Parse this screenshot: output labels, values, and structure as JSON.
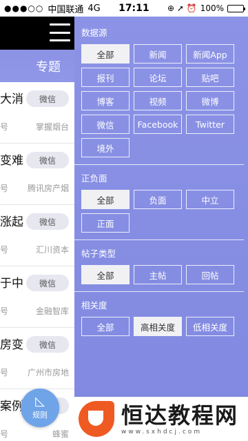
{
  "status_bar": {
    "signal": "●●●○○",
    "carrier": "中国联通",
    "network": "4G",
    "time": "17:11",
    "icons": "⊕ ➚ ⏰",
    "battery_pct": "100%",
    "battery_level": 1.0
  },
  "left": {
    "header": "专题",
    "items": [
      {
        "title": "大消",
        "badge": "微信",
        "meta_left": "号",
        "meta_right": "掌握烟台"
      },
      {
        "title": "变难",
        "badge": "微信",
        "meta_left": "号",
        "meta_right": "腾讯房产烟"
      },
      {
        "title": "涨起",
        "badge": "微信",
        "meta_left": "号",
        "meta_right": "汇川资本"
      },
      {
        "title": "于中",
        "badge": "微信",
        "meta_left": "号",
        "meta_right": "金融智库"
      },
      {
        "title": "房变",
        "badge": "微信",
        "meta_left": "号",
        "meta_right": "广州市房地"
      },
      {
        "title": "案例/",
        "badge": "微信",
        "meta_left": "号",
        "meta_right": "蜂蜜"
      }
    ],
    "rules_button": "规则"
  },
  "drawer": {
    "source": {
      "title": "数据源",
      "options": [
        "全部",
        "新闻",
        "新闻App",
        "报刊",
        "论坛",
        "贴吧",
        "博客",
        "视频",
        "微博",
        "微信",
        "Facebook",
        "Twitter",
        "境外"
      ],
      "selected": "全部"
    },
    "sentiment": {
      "title": "正负面",
      "options": [
        "全部",
        "负面",
        "中立",
        "正面"
      ],
      "selected": "全部"
    },
    "post_type": {
      "title": "帖子类型",
      "options": [
        "全部",
        "主帖",
        "回帖"
      ],
      "selected": "全部"
    },
    "relevance": {
      "title": "相关度",
      "options": [
        "全部",
        "高相关度",
        "低相关度"
      ],
      "selected": "高相关度"
    }
  },
  "watermark": {
    "title": "恒达教程网",
    "url": "www.sxhdcj.com"
  }
}
